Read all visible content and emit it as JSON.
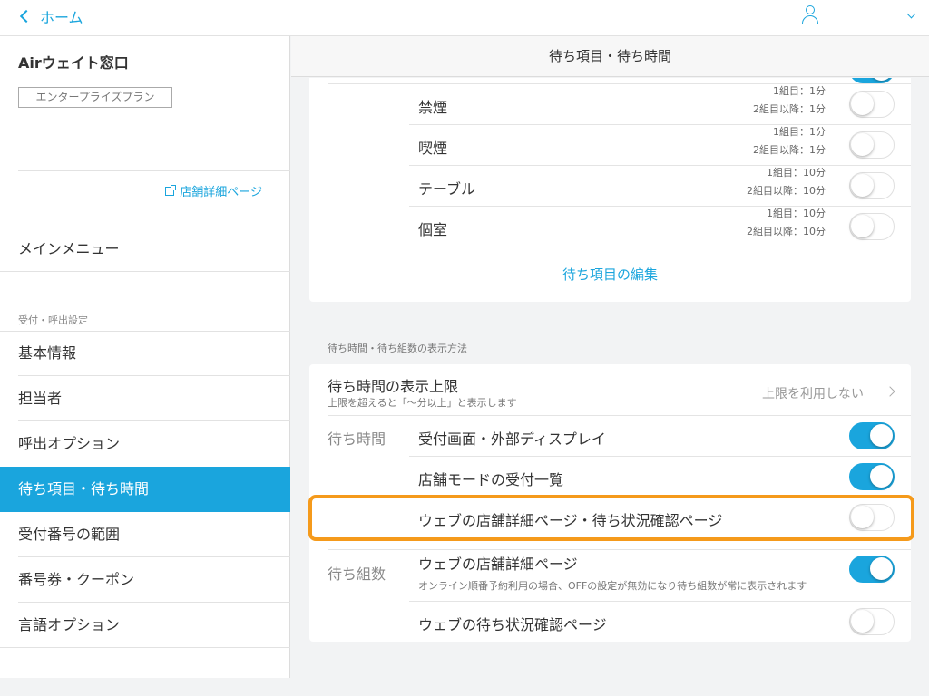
{
  "topbar": {
    "back_label": "ホーム"
  },
  "sidebar": {
    "store_name": "Airウェイト窓口",
    "plan": "エンタープライズプラン",
    "store_link": "店舗詳細ページ",
    "main_menu": "メインメニュー",
    "section_label": "受付・呼出設定",
    "items": [
      {
        "label": "基本情報"
      },
      {
        "label": "担当者"
      },
      {
        "label": "呼出オプション"
      },
      {
        "label": "待ち項目・待ち時間"
      },
      {
        "label": "受付番号の範囲"
      },
      {
        "label": "番号券・クーポン"
      },
      {
        "label": "言語オプション"
      }
    ],
    "active_index": 3
  },
  "header": {
    "title": "待ち項目・待ち時間"
  },
  "wait_items": {
    "items": [
      {
        "name": "禁煙",
        "first": "1組目：1分",
        "after": "2組目以降：1分",
        "enabled": false
      },
      {
        "name": "喫煙",
        "first": "1組目：1分",
        "after": "2組目以降：1分",
        "enabled": false
      },
      {
        "name": "テーブル",
        "first": "1組目：10分",
        "after": "2組目以降：10分",
        "enabled": false
      },
      {
        "name": "個室",
        "first": "1組目：10分",
        "after": "2組目以降：10分",
        "enabled": false
      }
    ],
    "edit_label": "待ち項目の編集"
  },
  "display": {
    "group_label": "待ち時間・待ち組数の表示方法",
    "limit": {
      "title": "待ち時間の表示上限",
      "subtitle": "上限を超えると「〜分以上」と表示します",
      "value": "上限を利用しない"
    },
    "wait_time": {
      "label": "待ち時間",
      "rows": [
        {
          "title": "受付画面・外部ディスプレイ",
          "enabled": true
        },
        {
          "title": "店舗モードの受付一覧",
          "enabled": true
        },
        {
          "title": "ウェブの店舗詳細ページ・待ち状況確認ページ",
          "enabled": false
        }
      ]
    },
    "wait_count": {
      "label": "待ち組数",
      "rows": [
        {
          "title": "ウェブの店舗詳細ページ",
          "note": "オンライン順番予約利用の場合、OFFの設定が無効になり待ち組数が常に表示されます",
          "enabled": true
        },
        {
          "title": "ウェブの待ち状況確認ページ",
          "enabled": false
        }
      ]
    }
  },
  "colors": {
    "accent": "#1aa5dd",
    "highlight": "#f59a1b"
  }
}
